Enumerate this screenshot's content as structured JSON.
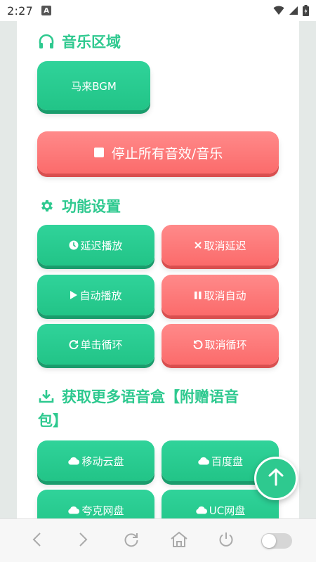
{
  "status_bar": {
    "time": "2:27",
    "badge": "A"
  },
  "music": {
    "title": "音乐区域",
    "bgm_button": "马来BGM",
    "stop_button": "停止所有音效/音乐"
  },
  "settings": {
    "title": "功能设置",
    "delay_play": "延迟播放",
    "cancel_delay": "取消延迟",
    "auto_play": "自动播放",
    "cancel_auto": "取消自动",
    "single_loop": "单击循环",
    "cancel_loop": "取消循环"
  },
  "download": {
    "title_line1": "获取更多语音盒【附赠语音",
    "title_line2": "包】",
    "mobile_cloud": "移动云盘",
    "baidu": "百度盘",
    "quark": "夸克网盘",
    "uc": "UC网盘"
  },
  "colors": {
    "accent": "#2ec98f",
    "danger": "#fb6b6b"
  }
}
